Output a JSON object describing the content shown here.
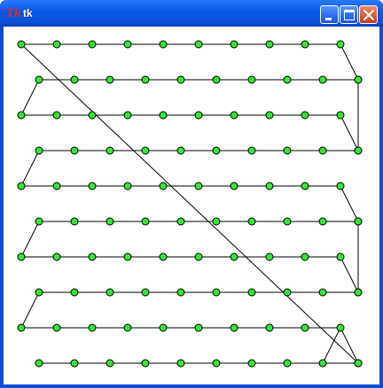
{
  "window": {
    "title": "tk",
    "title_icon_glyph": "Tk",
    "controls": [
      "minimize-icon",
      "maximize-icon",
      "close-icon"
    ]
  },
  "colors": {
    "title_bar": "#0a4fd8",
    "node_fill": "#33e833",
    "node_stroke": "#000000",
    "edge": "#000000",
    "canvas_bg": "#ffffff"
  },
  "graph": {
    "description_free": true,
    "columns": 10,
    "rows": 10
  }
}
